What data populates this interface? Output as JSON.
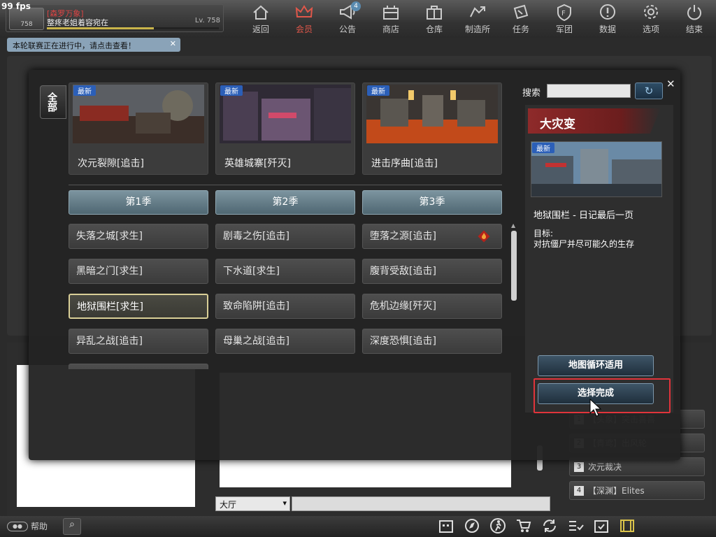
{
  "fps": "99 fps",
  "profile": {
    "clan": "[森罗万象]",
    "name": "整疼老姐着容宛在",
    "level": "Lv. 758",
    "rank": "758",
    "xp_fraction": 0.62
  },
  "nav": [
    {
      "label": "返回",
      "icon": "home-icon",
      "active": false
    },
    {
      "label": "会员",
      "icon": "crown-icon",
      "active": true
    },
    {
      "label": "公告",
      "icon": "megaphone-icon",
      "active": false,
      "badge": "4"
    },
    {
      "label": "商店",
      "icon": "shop-icon",
      "active": false
    },
    {
      "label": "仓库",
      "icon": "briefcase-icon",
      "active": false
    },
    {
      "label": "制造所",
      "icon": "workshop-icon",
      "active": false
    },
    {
      "label": "任务",
      "icon": "mission-icon",
      "active": false
    },
    {
      "label": "军团",
      "icon": "shield-icon",
      "active": false
    },
    {
      "label": "数据",
      "icon": "info-icon",
      "active": false
    },
    {
      "label": "选项",
      "icon": "gear-icon",
      "active": false
    },
    {
      "label": "结束",
      "icon": "power-icon",
      "active": false
    }
  ],
  "notice": "本轮联赛正在进行中，请点击查看！",
  "modal": {
    "all_tab": "全部",
    "new_tag": "最新",
    "featured": [
      {
        "title": "次元裂隙[追击]"
      },
      {
        "title": "英雄城寨[歼灭]"
      },
      {
        "title": "进击序曲[追击]"
      }
    ],
    "seasons": [
      "第1季",
      "第2季",
      "第3季"
    ],
    "maps": [
      [
        "失落之城[求生]",
        "剧毒之伤[追击]",
        "堕落之源[追击]"
      ],
      [
        "黑暗之门[求生]",
        "下水道[求生]",
        "腹背受敌[追击]"
      ],
      [
        "地狱围栏[求生]",
        "致命陷阱[追击]",
        "危机边缘[歼灭]"
      ],
      [
        "异乱之战[追击]",
        "母巢之战[追击]",
        "深度恐惧[追击]"
      ]
    ],
    "selected_map": "地狱围栏[求生]",
    "search_label": "搜索",
    "search_value": "",
    "detail": {
      "mode": "大灾变",
      "map_name": "地狱围栏 - 日记最后一页",
      "goal_label": "目标:",
      "goal_text": "对抗僵尸并尽可能久的生存"
    },
    "rotation_button": "地图循环适用",
    "confirm_button": "选择完成"
  },
  "channels": [
    {
      "num": "1",
      "label": "【头象】突击喜喜"
    },
    {
      "num": "2",
      "label": "【青鸢】出风轮"
    },
    {
      "num": "3",
      "label": "次元裁决"
    },
    {
      "num": "4",
      "label": "【深渊】Elites"
    }
  ],
  "chat": {
    "channel": "大厅",
    "input": ""
  },
  "help": "帮助",
  "colors": {
    "accent_red": "#e0343b",
    "season_blue": "#6b8590",
    "new_tag": "#2b5fb8",
    "mode_banner": "#8e2a2a"
  }
}
